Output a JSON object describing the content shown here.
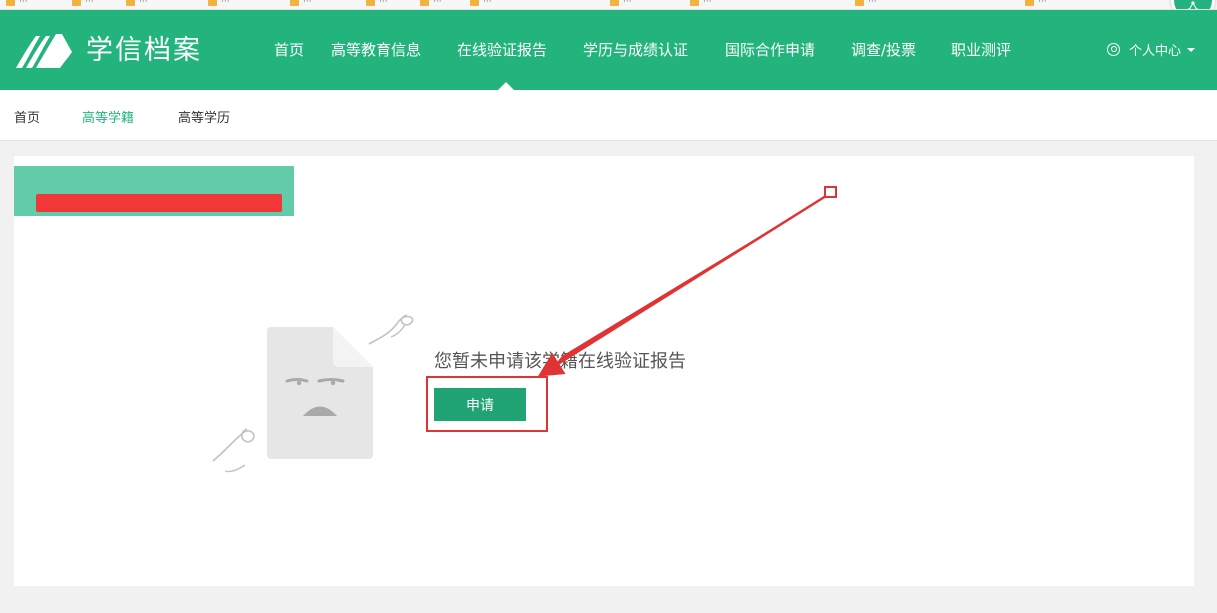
{
  "browser": {
    "bookmarks_count": 12
  },
  "header": {
    "logo_text": "学信档案",
    "nav": [
      {
        "label": "首页"
      },
      {
        "label": "高等教育信息"
      },
      {
        "label": "在线验证报告",
        "active": true
      },
      {
        "label": "学历与成绩认证"
      },
      {
        "label": "国际合作申请"
      },
      {
        "label": "调查/投票"
      },
      {
        "label": "职业测评"
      }
    ],
    "user_center": "个人中心"
  },
  "subnav": {
    "items": [
      {
        "label": "首页"
      },
      {
        "label": "高等学籍",
        "active": true
      },
      {
        "label": "高等学历"
      }
    ]
  },
  "main": {
    "empty_message": "您暂未申请该学籍在线验证报告",
    "apply_button": "申请"
  },
  "colors": {
    "brand": "#23b47e",
    "tab": "#62ccaa",
    "button": "#21a474",
    "annotation": "#e03434"
  },
  "icons": [
    "logo-book-icon",
    "user-icon",
    "chevron-down-icon",
    "empty-document-icon"
  ]
}
